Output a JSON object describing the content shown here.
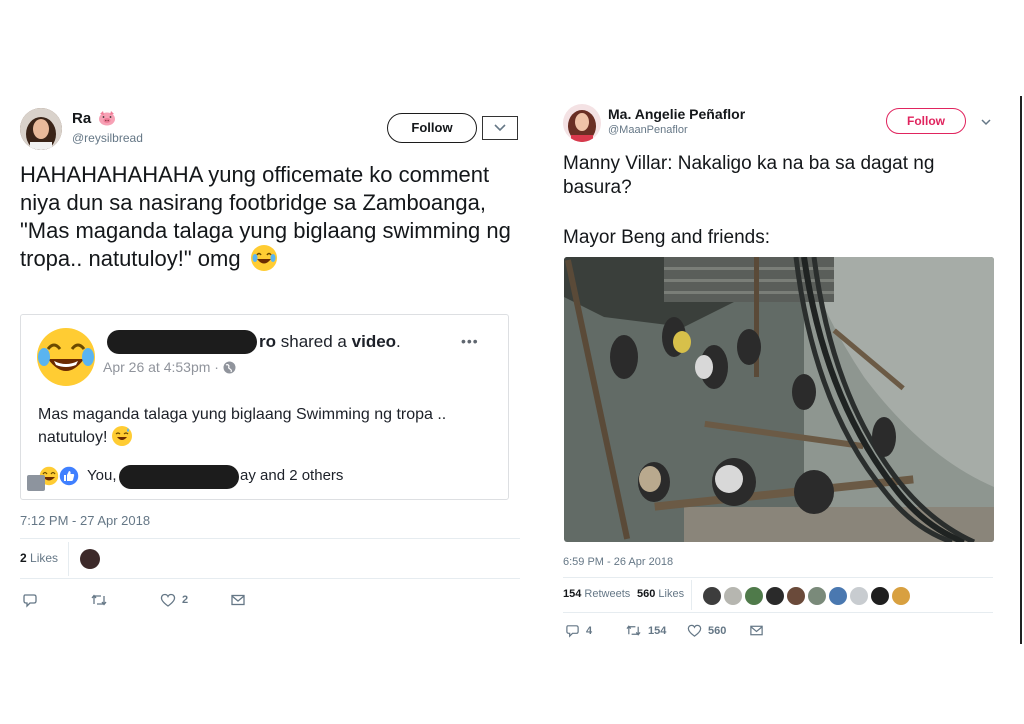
{
  "left_tweet": {
    "author_name": "Ra",
    "author_handle": "@reysilbread",
    "follow_label": "Follow",
    "text": "HAHAHAHAHAHA yung officemate ko comment niya dun sa nasirang footbridge sa Zamboanga, \"Mas maganda talaga yung biglaang swimming ng tropa.. natutuloy!\" omg",
    "embed": {
      "name_suffix": "ro",
      "shared_text": "shared a",
      "shared_type": "video",
      "shared_period": ".",
      "date": "Apr 26 at 4:53pm",
      "date_sep": "·",
      "more_label": "•••",
      "post_text": "Mas maganda talaga yung biglaang Swimming ng tropa .. natutuloy!",
      "reactions_prefix": "You,",
      "reactions_suffix": "ay and 2 others"
    },
    "timestamp": "7:12 PM - 27 Apr 2018",
    "likes_count": "2",
    "likes_label": "Likes",
    "action_like_count": "2"
  },
  "right_tweet": {
    "author_name": "Ma. Angelie Peñaflor",
    "author_handle": "@MaanPenaflor",
    "follow_label": "Follow",
    "text_line1": "Manny Villar: Nakaligo ka na ba sa dagat ng basura?",
    "text_line2": "Mayor Beng and friends:",
    "timestamp": "6:59 PM - 26 Apr 2018",
    "retweets_count": "154",
    "retweets_label": "Retweets",
    "likes_count": "560",
    "likes_label": "Likes",
    "action_reply_count": "4",
    "action_retweet_count": "154",
    "action_like_count": "560"
  },
  "colors": {
    "follow_blue": "#1da1f2",
    "follow_pink": "#e0245e",
    "muted": "#657786",
    "water": "#5c6660"
  },
  "icons": [
    "pig-icon",
    "chevron-down-icon",
    "reply-icon",
    "retweet-icon",
    "heart-icon",
    "message-icon",
    "globe-icon",
    "laughing-emoji-icon",
    "sweat-smile-emoji-icon",
    "like-reaction-icon"
  ]
}
